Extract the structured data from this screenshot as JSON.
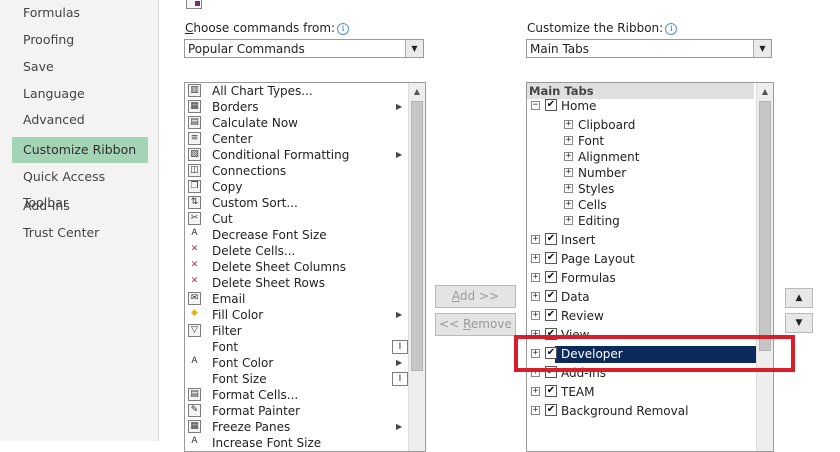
{
  "sidebar": {
    "items": [
      {
        "label": "Formulas",
        "selected": false
      },
      {
        "label": "Proofing",
        "selected": false
      },
      {
        "label": "Save",
        "selected": false
      },
      {
        "label": "Language",
        "selected": false
      },
      {
        "label": "Advanced",
        "selected": false
      },
      {
        "label": "Customize Ribbon",
        "selected": true
      },
      {
        "label": "Quick Access Toolbar",
        "selected": false
      },
      {
        "label": "Add-Ins",
        "selected": false
      },
      {
        "label": "Trust Center",
        "selected": false
      }
    ]
  },
  "commands_panel": {
    "label_prefix": "C",
    "label_rest": "hoose commands from:",
    "dropdown_value": "Popular Commands",
    "items": [
      {
        "label": "All Chart Types...",
        "icon": "chart-icon",
        "has_submenu": false
      },
      {
        "label": "Borders",
        "icon": "borders-icon",
        "has_submenu": true
      },
      {
        "label": "Calculate Now",
        "icon": "calculator-icon",
        "has_submenu": false
      },
      {
        "label": "Center",
        "icon": "align-center-icon",
        "has_submenu": false
      },
      {
        "label": "Conditional Formatting",
        "icon": "conditional-formatting-icon",
        "has_submenu": true
      },
      {
        "label": "Connections",
        "icon": "connections-icon",
        "has_submenu": false
      },
      {
        "label": "Copy",
        "icon": "copy-icon",
        "has_submenu": false
      },
      {
        "label": "Custom Sort...",
        "icon": "sort-icon",
        "has_submenu": false
      },
      {
        "label": "Cut",
        "icon": "scissors-icon",
        "has_submenu": false
      },
      {
        "label": "Decrease Font Size",
        "icon": "decrease-font-icon",
        "has_submenu": false
      },
      {
        "label": "Delete Cells...",
        "icon": "delete-cells-icon",
        "has_submenu": false
      },
      {
        "label": "Delete Sheet Columns",
        "icon": "delete-columns-icon",
        "has_submenu": false
      },
      {
        "label": "Delete Sheet Rows",
        "icon": "delete-rows-icon",
        "has_submenu": false
      },
      {
        "label": "Email",
        "icon": "email-icon",
        "has_submenu": false
      },
      {
        "label": "Fill Color",
        "icon": "fill-color-icon",
        "has_submenu": true
      },
      {
        "label": "Filter",
        "icon": "filter-icon",
        "has_submenu": false
      },
      {
        "label": "Font",
        "icon": "",
        "has_submenu": false,
        "extra": "I"
      },
      {
        "label": "Font Color",
        "icon": "font-color-icon",
        "has_submenu": true
      },
      {
        "label": "Font Size",
        "icon": "",
        "has_submenu": false,
        "extra": "I"
      },
      {
        "label": "Format Cells...",
        "icon": "format-cells-icon",
        "has_submenu": false
      },
      {
        "label": "Format Painter",
        "icon": "format-painter-icon",
        "has_submenu": false
      },
      {
        "label": "Freeze Panes",
        "icon": "freeze-panes-icon",
        "has_submenu": true
      },
      {
        "label": "Increase Font Size",
        "icon": "increase-font-icon",
        "has_submenu": false
      }
    ]
  },
  "ribbon_panel": {
    "label": "Customize the Ribbon:",
    "dropdown_value": "Main Tabs",
    "group_header": "Main Tabs",
    "tabs": [
      {
        "label": "Home",
        "expanded": true,
        "checked": true
      },
      {
        "label": "Insert",
        "expanded": false,
        "checked": true
      },
      {
        "label": "Page Layout",
        "expanded": false,
        "checked": true
      },
      {
        "label": "Formulas",
        "expanded": false,
        "checked": true
      },
      {
        "label": "Data",
        "expanded": false,
        "checked": true
      },
      {
        "label": "Review",
        "expanded": false,
        "checked": true
      },
      {
        "label": "View",
        "expanded": false,
        "checked": true
      },
      {
        "label": "Developer",
        "expanded": false,
        "checked": true,
        "selected": true
      },
      {
        "label": "Add-Ins",
        "expanded": false,
        "checked": true
      },
      {
        "label": "TEAM",
        "expanded": false,
        "checked": true
      },
      {
        "label": "Background Removal",
        "expanded": false,
        "checked": true
      }
    ],
    "home_groups": [
      "Clipboard",
      "Font",
      "Alignment",
      "Number",
      "Styles",
      "Cells",
      "Editing"
    ]
  },
  "buttons": {
    "add_prefix": "A",
    "add_rest": "dd >>",
    "remove_prefix": "<< ",
    "remove_underlined": "R",
    "remove_rest": "emove",
    "move_up": "▲",
    "move_down": "▼"
  },
  "colors": {
    "sidebar_selected": "#a4d3b5",
    "tree_selected": "#0d2a5c",
    "highlight_box": "#d81e2a"
  }
}
